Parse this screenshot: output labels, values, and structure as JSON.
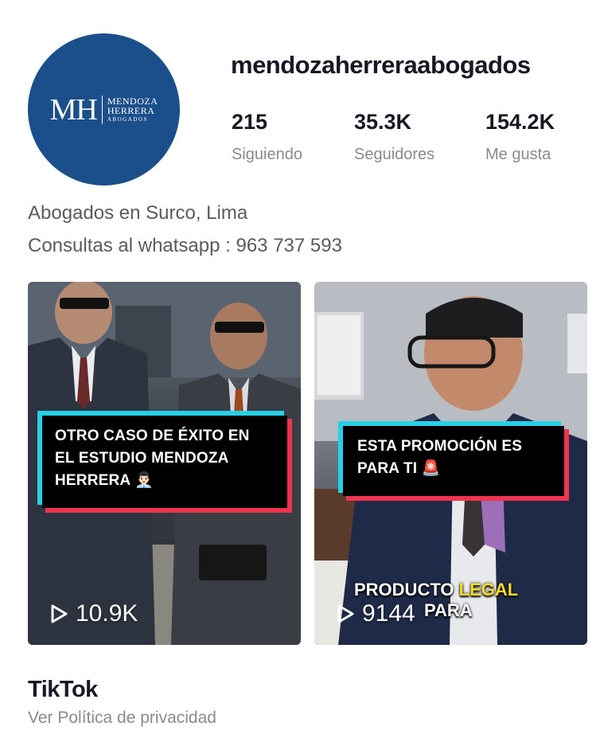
{
  "profile": {
    "username": "mendozaherreraabogados",
    "avatar_logo": {
      "mark": "MH",
      "line1": "MENDOZA",
      "line2": "HERRERA",
      "line3": "ABOGADOS"
    },
    "stats": [
      {
        "value": "215",
        "label": "Siguiendo"
      },
      {
        "value": "35.3K",
        "label": "Seguidores"
      },
      {
        "value": "154.2K",
        "label": "Me gusta"
      }
    ],
    "bio": [
      "Abogados en Surco, Lima",
      "Consultas al whatsapp : 963 737 593"
    ]
  },
  "videos": [
    {
      "caption_lines": [
        "OTRO CASO DE ÉXITO EN",
        "EL ESTUDIO MENDOZA",
        "HERRERA 👨🏻‍💼"
      ],
      "views": "10.9K"
    },
    {
      "caption_lines": [
        "ESTA PROMOCIÓN ES",
        "PARA TI 🚨"
      ],
      "overlay_text": {
        "word1": "PRODUCTO",
        "word2": "LEGAL",
        "word3": "PARA"
      },
      "views": "9144"
    }
  ],
  "footer": {
    "brand": "TikTok",
    "privacy_link": "Ver Política de privacidad"
  },
  "colors": {
    "avatar_bg": "#1a4f8b",
    "caption_cyan": "#25d1e6",
    "caption_red": "#f0334f",
    "highlight_yellow": "#f5dc2b"
  },
  "icons": {
    "play": "play-icon"
  }
}
